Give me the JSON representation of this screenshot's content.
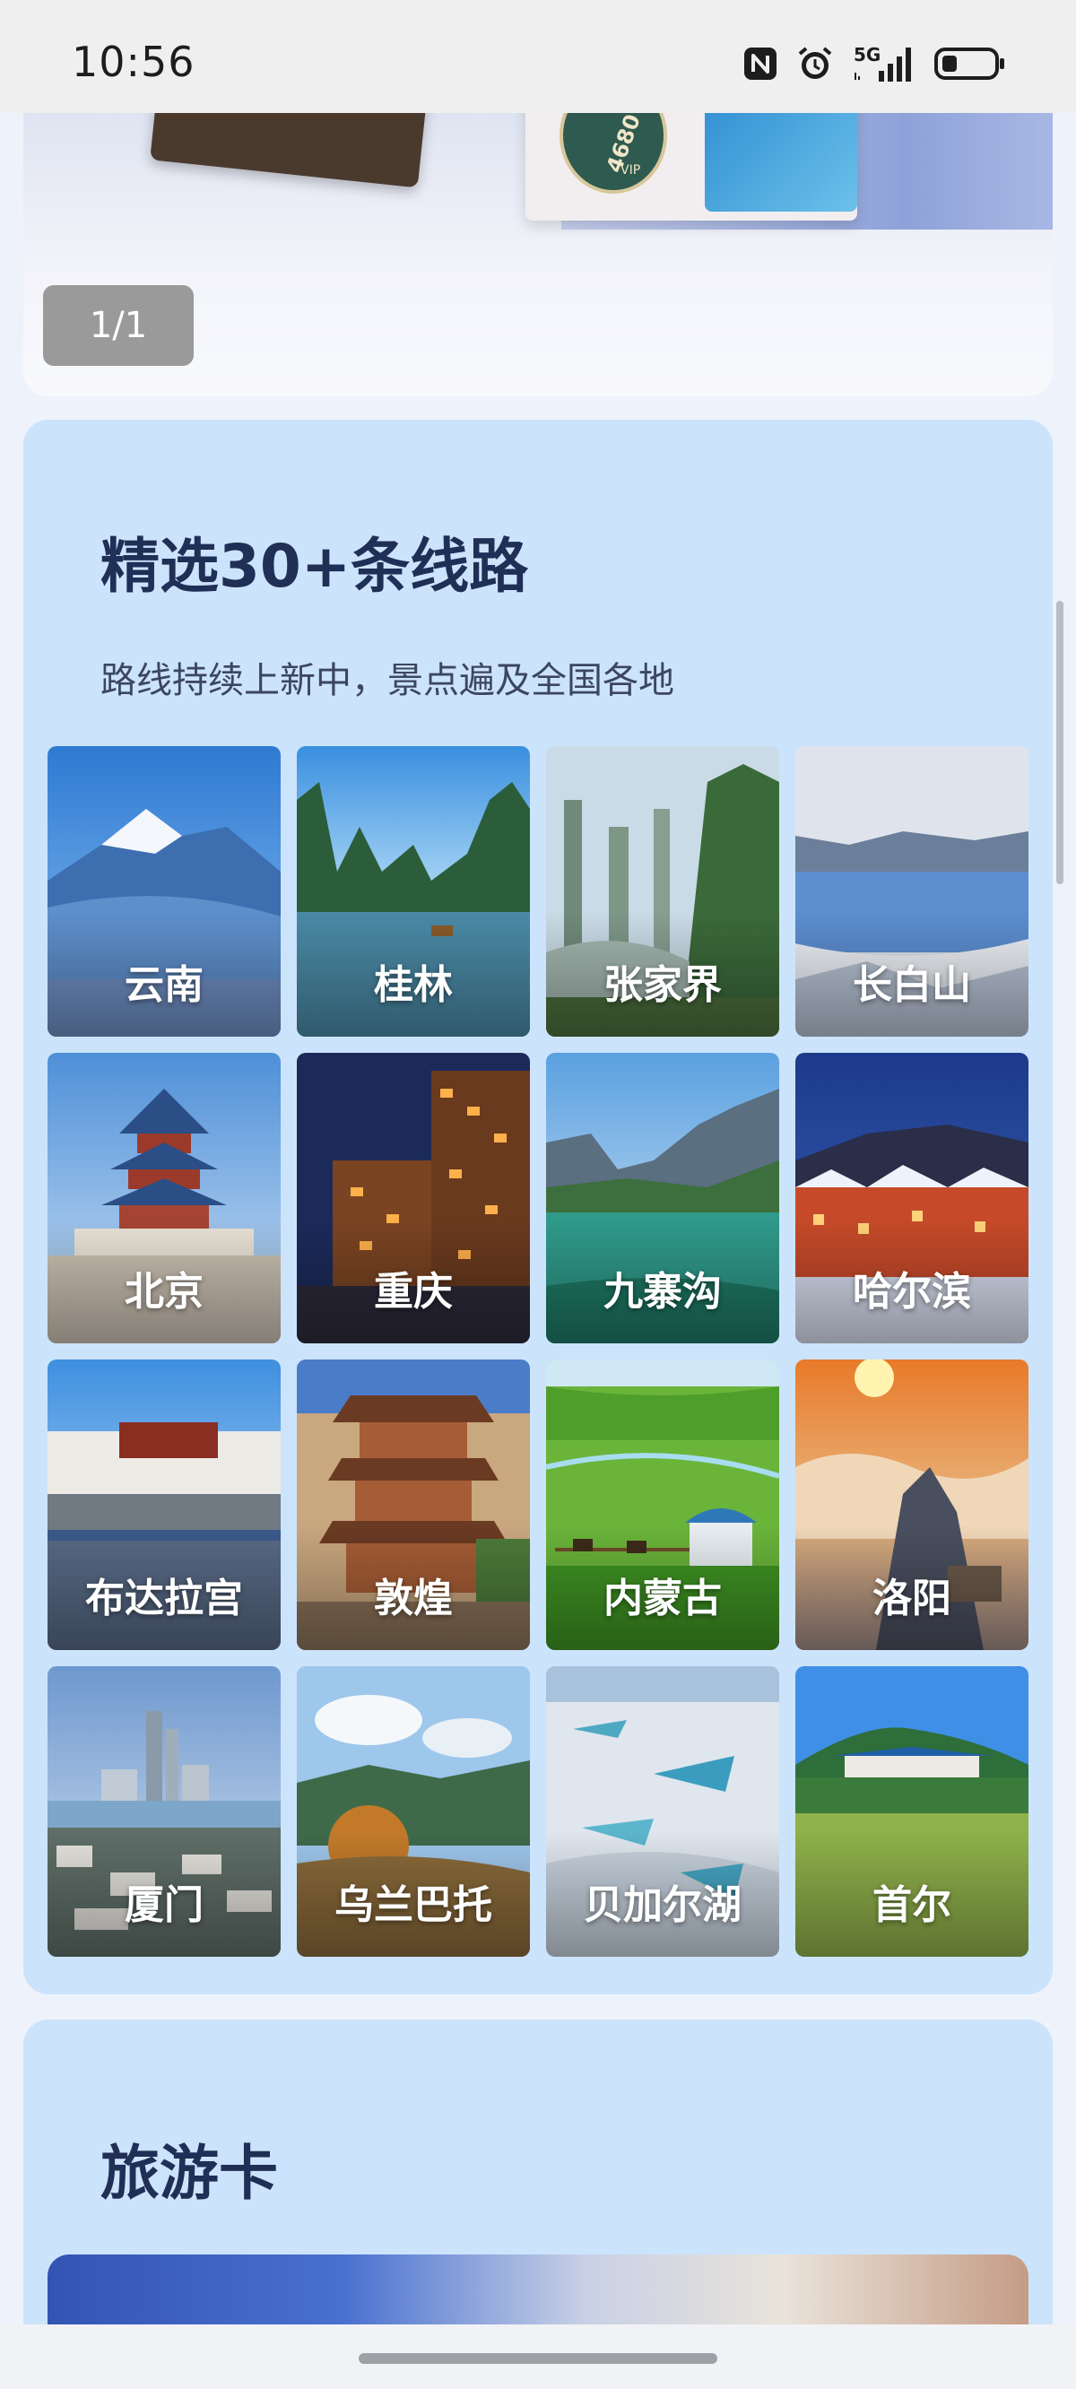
{
  "status_bar": {
    "time": "10:56",
    "icons": [
      "nfc-icon",
      "alarm-icon",
      "signal-5g-icon",
      "battery-icon"
    ],
    "network_label": "5G"
  },
  "banner": {
    "counter": "1/1",
    "card_text": "4680",
    "card_badge": "VIP"
  },
  "routes": {
    "title": "精选30+条线路",
    "subtitle": "路线持续上新中，景点遍及全国各地",
    "items": [
      {
        "label": "云南",
        "scene": "snow-mountain"
      },
      {
        "label": "桂林",
        "scene": "karst-river"
      },
      {
        "label": "张家界",
        "scene": "misty-peaks"
      },
      {
        "label": "长白山",
        "scene": "crater-lake"
      },
      {
        "label": "北京",
        "scene": "temple-of-heaven"
      },
      {
        "label": "重庆",
        "scene": "night-city"
      },
      {
        "label": "九寨沟",
        "scene": "valley-lake"
      },
      {
        "label": "哈尔滨",
        "scene": "snow-village"
      },
      {
        "label": "布达拉宫",
        "scene": "potala-palace"
      },
      {
        "label": "敦煌",
        "scene": "cave-temple"
      },
      {
        "label": "内蒙古",
        "scene": "grassland"
      },
      {
        "label": "洛阳",
        "scene": "sunrise-clouds"
      },
      {
        "label": "厦门",
        "scene": "coastal-city"
      },
      {
        "label": "乌兰巴托",
        "scene": "autumn-hills"
      },
      {
        "label": "贝加尔湖",
        "scene": "ice-lake"
      },
      {
        "label": "首尔",
        "scene": "blue-house"
      }
    ]
  },
  "travel_card": {
    "title": "旅游卡"
  },
  "colors": {
    "section_bg": "#cce3fc",
    "title": "#1f2f55",
    "subtitle": "#3c4660",
    "status_bg": "#efefef"
  }
}
